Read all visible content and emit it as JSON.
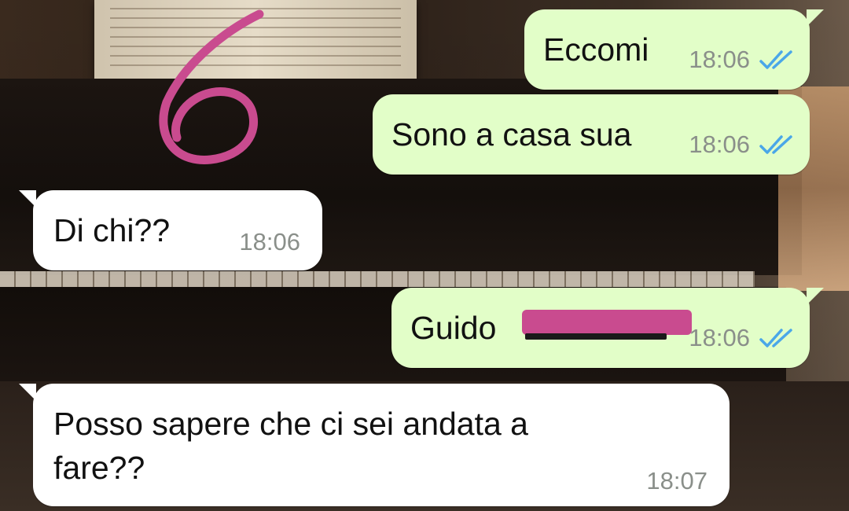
{
  "messages": [
    {
      "direction": "outgoing",
      "text": "Eccomi",
      "time": "18:06",
      "status": "read"
    },
    {
      "direction": "outgoing",
      "text": "Sono a casa sua",
      "time": "18:06",
      "status": "read"
    },
    {
      "direction": "incoming",
      "text": "Di chi??",
      "time": "18:06"
    },
    {
      "direction": "outgoing",
      "text": "Guido",
      "time": "18:06",
      "status": "read",
      "redacted_suffix": true
    },
    {
      "direction": "incoming",
      "text_line1": "Posso sapere che ci sei andata a",
      "text_line2": "fare??",
      "time": "18:07"
    }
  ],
  "annotation": {
    "label": "6",
    "color": "#c94b8f"
  },
  "colors": {
    "outgoing_bubble": "#e2fec8",
    "incoming_bubble": "#ffffff",
    "read_ticks": "#4aa7e8",
    "timestamp": "#8a8f8a",
    "redaction": "#c94b8f"
  },
  "icons": {
    "read_receipt": "double-check-icon"
  }
}
